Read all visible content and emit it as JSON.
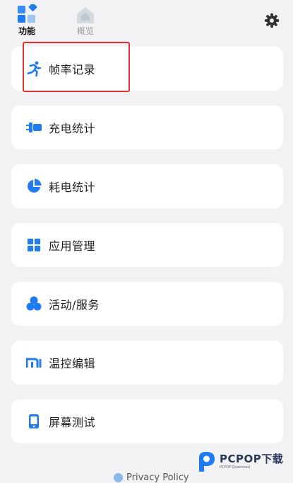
{
  "tabs": [
    {
      "label": "功能",
      "icon": "grid-diamond-icon",
      "active": true
    },
    {
      "label": "概览",
      "icon": "home-icon",
      "active": false
    }
  ],
  "settings": {
    "icon": "gear-icon"
  },
  "menu": [
    {
      "label": "帧率记录",
      "icon": "running-icon"
    },
    {
      "label": "充电统计",
      "icon": "charger-plug-icon"
    },
    {
      "label": "耗电统计",
      "icon": "pie-chart-icon"
    },
    {
      "label": "应用管理",
      "icon": "app-grid-icon"
    },
    {
      "label": "活动/服务",
      "icon": "three-circles-icon"
    },
    {
      "label": "温控编辑",
      "icon": "mi-logo-icon"
    },
    {
      "label": "屏幕测试",
      "icon": "phone-screen-icon"
    }
  ],
  "footer": {
    "privacy": "Privacy Policy"
  },
  "watermark": {
    "main": "PCPOP下载",
    "sub": "PCPOP Download"
  },
  "colors": {
    "accent": "#1f7bf2",
    "background": "#f2f2f4",
    "card": "#ffffff",
    "highlight": "#e53130"
  }
}
